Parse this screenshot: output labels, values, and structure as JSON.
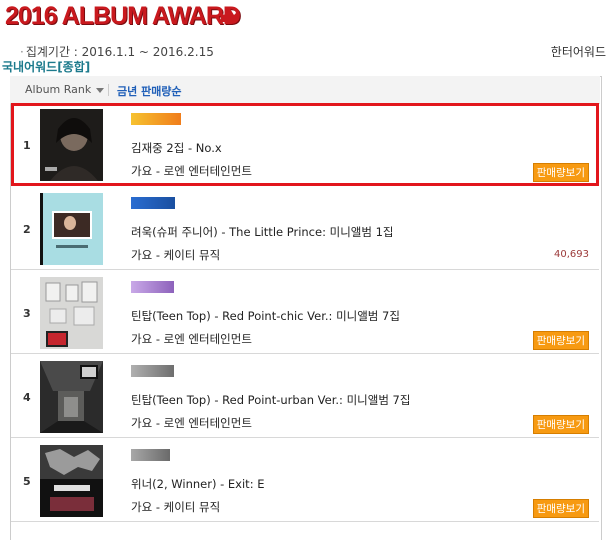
{
  "header": {
    "title": "2016 ALBUM AWARD",
    "period_prefix": "·",
    "period": "집계기간 : 2016.1.1 ~ 2016.2.15",
    "other_award_link": "한터어워드",
    "category_tab": "국내어워드[종합]"
  },
  "sort_bar": {
    "rank_label": "Album Rank",
    "sales_sort_label": "금년 판매량순"
  },
  "colors": {
    "accent_red": "#c9191e",
    "highlight_border": "#e2161c",
    "sales_button": "#f79a12",
    "link_blue": "#1f5fb8"
  },
  "albums": [
    {
      "rank": "1",
      "album": "김재중 2집 - No.x",
      "genre": "가요 - 로엔 엔터테인먼트",
      "sales_button": "판매량보기",
      "sales": "",
      "bar_color": "#f59a18",
      "bar_fraction": 0.85,
      "highlighted": true
    },
    {
      "rank": "2",
      "album": "려욱(슈퍼 주니어) - The Little Prince: 미니앨범 1집",
      "genre": "가요 - 케이티 뮤직",
      "sales_button": "",
      "sales": "40,693",
      "bar_color": "#1f5fb8",
      "bar_fraction": 0.75,
      "highlighted": false
    },
    {
      "rank": "3",
      "album": "틴탑(Teen Top) - Red Point-chic Ver.: 미니앨범 7집",
      "genre": "가요 - 로엔 엔터테인먼트",
      "sales_button": "판매량보기",
      "sales": "",
      "bar_color": "#a57fcb",
      "bar_fraction": 0.72,
      "highlighted": false
    },
    {
      "rank": "4",
      "album": "틴탑(Teen Top) - Red Point-urban Ver.: 미니앨범 7집",
      "genre": "가요 - 로엔 엔터테인먼트",
      "sales_button": "판매량보기",
      "sales": "",
      "bar_color": "#8d8d8d",
      "bar_fraction": 0.72,
      "highlighted": false
    },
    {
      "rank": "5",
      "album": "위너(2, Winner) - Exit: E",
      "genre": "가요 - 케이티 뮤직",
      "sales_button": "판매량보기",
      "sales": "",
      "bar_color": "#8d8d8d",
      "bar_fraction": 0.66,
      "highlighted": false
    }
  ]
}
